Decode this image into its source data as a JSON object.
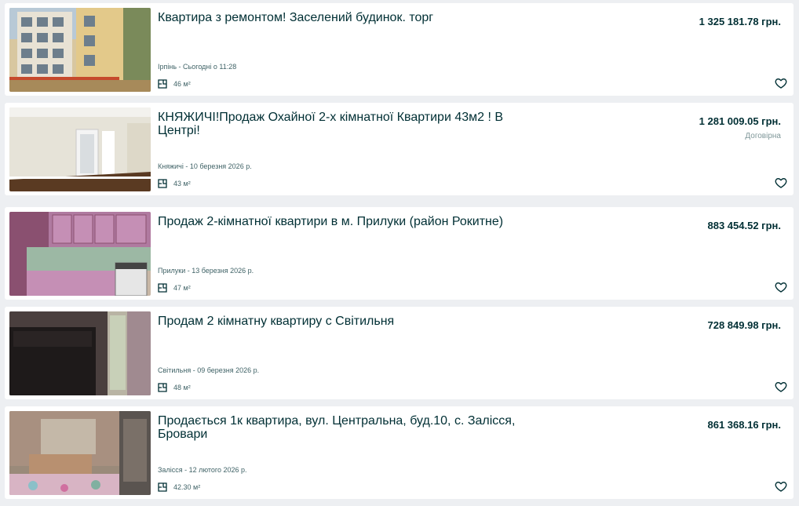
{
  "listings": [
    {
      "title": "Квартира з ремонтом! Заселений будинок. торг",
      "price": "1 325 181.78 грн.",
      "negotiable": "",
      "location_date": "Ірпінь - Сьогодні о 11:28",
      "area": "46 м²"
    },
    {
      "title": "КНЯЖИЧІ!Продаж Охайної 2-х кімнатної Квартири 43м2 ! В Центрі!",
      "price": "1 281 009.05 грн.",
      "negotiable": "Договірна",
      "location_date": "Княжичі - 10 березня 2026 р.",
      "area": "43 м²"
    },
    {
      "title": "Продаж 2-кімнатної квартири в м. Прилуки (район Рокитне)",
      "price": "883 454.52 грн.",
      "negotiable": "",
      "location_date": "Прилуки - 13 березня 2026 р.",
      "area": "47 м²"
    },
    {
      "title": "Продам 2 кімнатну квартиру с Світильня",
      "price": "728 849.98 грн.",
      "negotiable": "",
      "location_date": "Світильня - 09 березня 2026 р.",
      "area": "48 м²"
    },
    {
      "title": "Продається 1к квартира, вул. Центральна, буд.10, с. Залісся, Бровари",
      "price": "861 368.16 грн.",
      "negotiable": "",
      "location_date": "Залісся - 12 лютого 2026 р.",
      "area": "42.30 м²"
    }
  ]
}
